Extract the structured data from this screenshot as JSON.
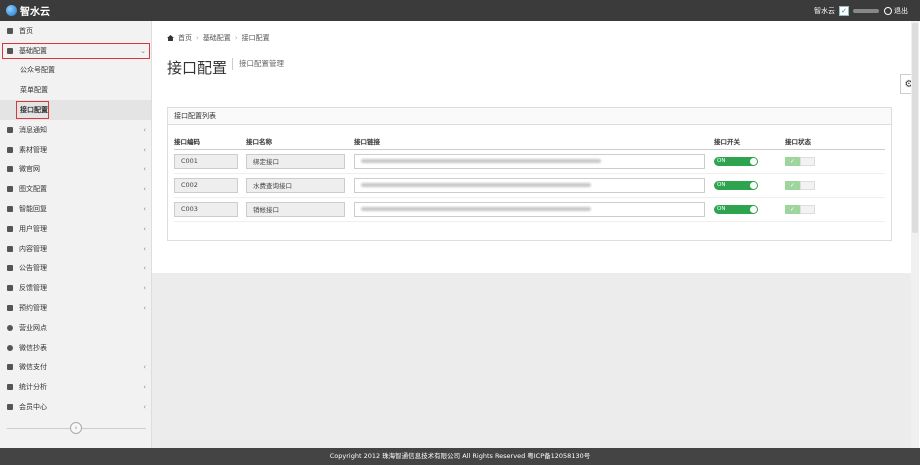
{
  "app": {
    "title": "智水云"
  },
  "user": {
    "name": "智水云",
    "logout": "退出"
  },
  "sidebar": {
    "items": [
      {
        "label": "首页",
        "arrow": ""
      },
      {
        "label": "基础配置",
        "arrow": "⌄"
      },
      {
        "label": "公众号配置",
        "arrow": ""
      },
      {
        "label": "菜单配置",
        "arrow": ""
      },
      {
        "label": "接口配置",
        "arrow": ""
      },
      {
        "label": "消息通知",
        "arrow": "‹"
      },
      {
        "label": "素材管理",
        "arrow": "‹"
      },
      {
        "label": "微官网",
        "arrow": "‹"
      },
      {
        "label": "图文配置",
        "arrow": "‹"
      },
      {
        "label": "智能回复",
        "arrow": "‹"
      },
      {
        "label": "用户管理",
        "arrow": "‹"
      },
      {
        "label": "内容管理",
        "arrow": "‹"
      },
      {
        "label": "公告管理",
        "arrow": "‹"
      },
      {
        "label": "反馈管理",
        "arrow": "‹"
      },
      {
        "label": "预约管理",
        "arrow": "‹"
      },
      {
        "label": "营业网点",
        "arrow": ""
      },
      {
        "label": "微信抄表",
        "arrow": ""
      },
      {
        "label": "微信支付",
        "arrow": "‹"
      },
      {
        "label": "统计分析",
        "arrow": "‹"
      },
      {
        "label": "会员中心",
        "arrow": "‹"
      }
    ]
  },
  "breadcrumb": {
    "home": "首页",
    "level1": "基础配置",
    "level2": "接口配置"
  },
  "page": {
    "title": "接口配置",
    "subtitle": "接口配置管理"
  },
  "panel": {
    "title": "接口配置列表"
  },
  "table": {
    "headers": {
      "code": "接口编码",
      "name": "接口名称",
      "url": "接口链接",
      "switch": "接口开关",
      "status": "接口状态"
    },
    "rows": [
      {
        "code": "C001",
        "name": "绑定接口",
        "switch": "ON"
      },
      {
        "code": "C002",
        "name": "水费查询接口",
        "switch": "ON"
      },
      {
        "code": "C003",
        "name": "销帐接口",
        "switch": "ON"
      }
    ]
  },
  "footer": {
    "text": "Copyright 2012 珠海智通信息技术有限公司 All Rights Reserved 粤ICP备12058130号"
  }
}
